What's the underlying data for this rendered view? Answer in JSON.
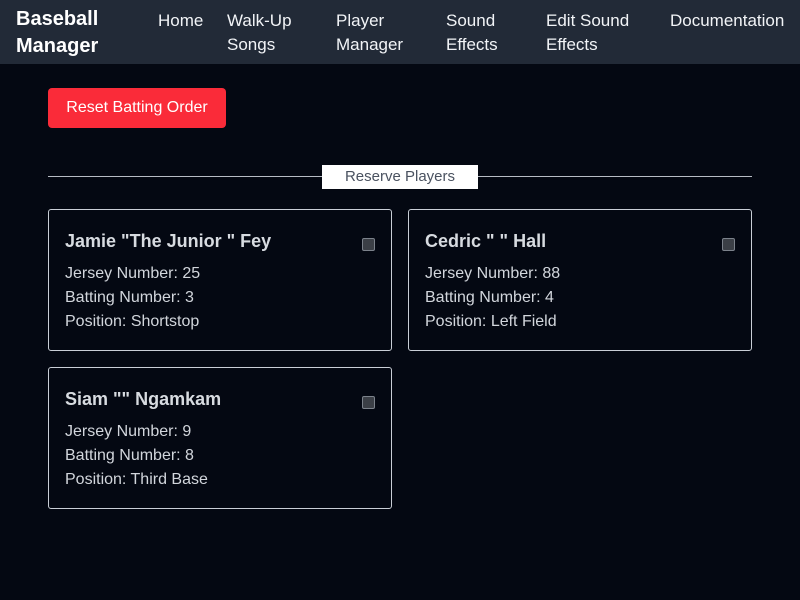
{
  "navbar": {
    "brand": "Baseball Manager",
    "links": [
      {
        "label": "Home"
      },
      {
        "label": "Walk-Up Songs"
      },
      {
        "label": "Player Manager"
      },
      {
        "label": "Sound Effects"
      },
      {
        "label": "Edit Sound Effects"
      },
      {
        "label": "Documentation"
      }
    ]
  },
  "actions": {
    "reset_label": "Reset Batting Order"
  },
  "section": {
    "title": "Reserve Players"
  },
  "colors": {
    "navbar_bg": "#222a37",
    "page_bg": "#040812",
    "danger": "#fa2b39"
  },
  "players": [
    {
      "name": "Jamie \"The Junior \" Fey",
      "jersey": "Jersey Number: 25",
      "batting": "Batting Number: 3",
      "position": "Position: Shortstop",
      "selected": false
    },
    {
      "name": "Cedric \" \" Hall",
      "jersey": "Jersey Number: 88",
      "batting": "Batting Number: 4",
      "position": "Position: Left Field",
      "selected": false
    },
    {
      "name": "Siam \"\" Ngamkam",
      "jersey": "Jersey Number: 9",
      "batting": "Batting Number: 8",
      "position": "Position: Third Base",
      "selected": false
    }
  ]
}
